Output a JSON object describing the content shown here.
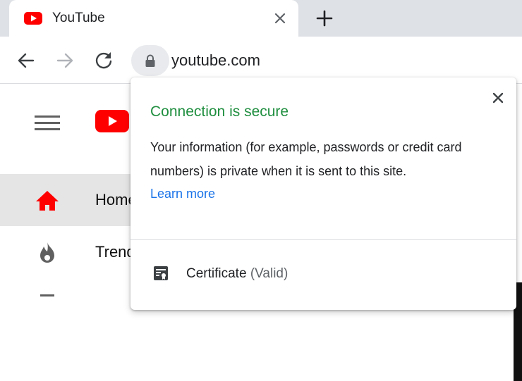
{
  "browser": {
    "tab": {
      "title": "YouTube",
      "favicon": "youtube-icon"
    },
    "toolbar": {
      "back_icon": "back-arrow-icon",
      "forward_icon": "forward-arrow-icon",
      "reload_icon": "reload-icon",
      "lock_icon": "lock-icon",
      "url": "youtube.com"
    }
  },
  "page": {
    "sidebar": [
      {
        "label": "Home",
        "icon": "home-icon",
        "active": true
      },
      {
        "label": "Trending",
        "icon": "flame-icon",
        "active": false
      }
    ]
  },
  "site_info_bubble": {
    "title": "Connection is secure",
    "description": "Your information (for example, passwords or credit card numbers) is private when it is sent to this site.",
    "learn_more": "Learn more",
    "certificate_label": "Certificate",
    "certificate_status": "(Valid)"
  },
  "colors": {
    "secure_green": "#1e8e3e",
    "link_blue": "#1a73e8",
    "youtube_red": "#ff0000",
    "tabstrip_bg": "#dee1e6"
  }
}
